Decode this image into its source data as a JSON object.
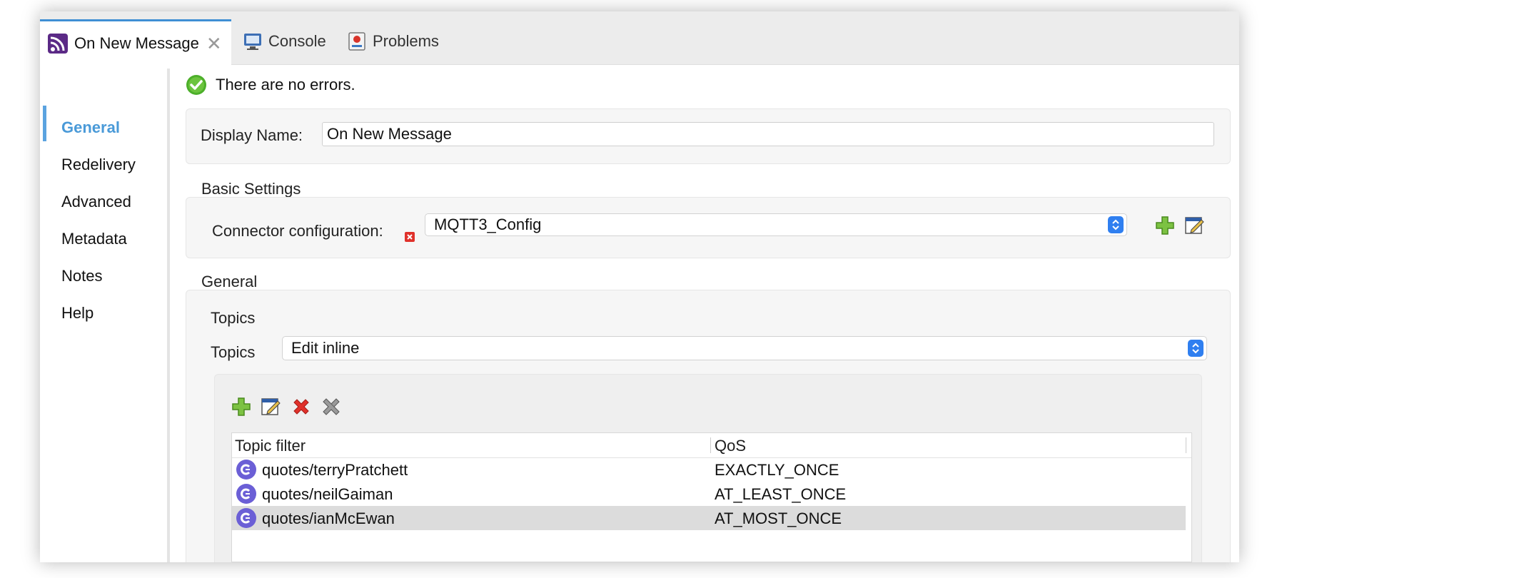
{
  "tabs": [
    {
      "label": "On New Message",
      "icon": "mqtt-feed-icon",
      "active": true,
      "closable": true
    },
    {
      "label": "Console",
      "icon": "console-icon",
      "active": false
    },
    {
      "label": "Problems",
      "icon": "problems-icon",
      "active": false
    }
  ],
  "nav": {
    "items": [
      "General",
      "Redelivery",
      "Advanced",
      "Metadata",
      "Notes",
      "Help"
    ],
    "active": "General"
  },
  "status": {
    "text": "There are no errors.",
    "icon": "check-circle-icon"
  },
  "display_name": {
    "label": "Display Name:",
    "value": "On New Message"
  },
  "basic_settings": {
    "title": "Basic Settings",
    "connector_label": "Connector configuration:",
    "connector_value": "MQTT3_Config"
  },
  "general": {
    "title": "General",
    "topics_group_title": "Topics",
    "topics_label": "Topics",
    "topics_value": "Edit inline"
  },
  "table": {
    "columns": [
      "Topic filter",
      "QoS"
    ],
    "rows": [
      {
        "topic": "quotes/terryPratchett",
        "qos": "EXACTLY_ONCE",
        "selected": false
      },
      {
        "topic": "quotes/neilGaiman",
        "qos": "AT_LEAST_ONCE",
        "selected": false
      },
      {
        "topic": "quotes/ianMcEwan",
        "qos": "AT_MOST_ONCE",
        "selected": true
      }
    ]
  },
  "colors": {
    "accent": "#4a9ad8",
    "tab_highlight": "#3f8fd4",
    "select_spinner": "#2f7ff0",
    "add_green": "#5aa321",
    "delete_red": "#e0312b",
    "topic_icon": "#6b5fd6"
  }
}
